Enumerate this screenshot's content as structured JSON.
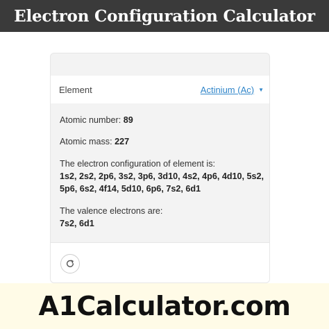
{
  "header": {
    "title": "Electron Configuration Calculator"
  },
  "form": {
    "element_label": "Element",
    "element_value": "Actinium (Ac)"
  },
  "results": {
    "atomic_number_label": "Atomic number: ",
    "atomic_number_value": "89",
    "atomic_mass_label": "Atomic mass: ",
    "atomic_mass_value": "227",
    "config_label": "The electron configuration of element is:",
    "config_line1": "1s2, 2s2, 2p6, 3s2, 3p6, 3d10, 4s2, 4p6, 4d10, 5s2,",
    "config_line2": "5p6, 6s2, 4f14, 5d10, 6p6, 7s2, 6d1",
    "valence_label": "The valence electrons are:",
    "valence_value": "7s2, 6d1"
  },
  "icons": {
    "reset": "refresh-icon",
    "dropdown": "caret-down-icon"
  },
  "brand": {
    "text": "A1Calculator.com"
  },
  "colors": {
    "header_bg": "#3a3a3a",
    "link": "#2f85c9",
    "card_bg": "#f3f3f3",
    "brand_bg": "#fffbe7"
  }
}
